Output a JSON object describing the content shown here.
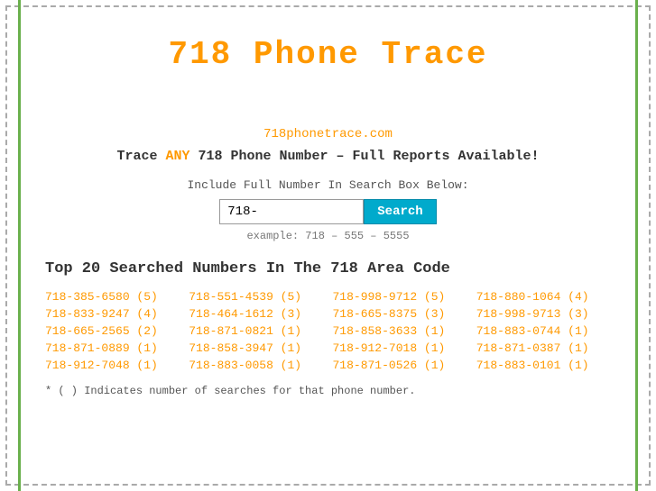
{
  "page": {
    "title": "718 Phone Trace",
    "site_url": "718phonetrace.com",
    "tagline_start": "Trace ",
    "tagline_highlight": "ANY",
    "tagline_end": " 718 Phone Number – Full Reports Available!",
    "search_label": "Include Full Number In Search Box Below:",
    "search_placeholder": "718-",
    "search_button_label": "Search",
    "search_example": "example: 718 – 555 – 5555",
    "section_title": "Top 20 Searched Numbers In The 718 Area Code",
    "footnote": "* ( ) Indicates number of searches for that phone number."
  },
  "numbers": [
    {
      "label": "718-385-6580 (5)",
      "col": 0
    },
    {
      "label": "718-551-4539 (5)",
      "col": 1
    },
    {
      "label": "718-998-9712 (5)",
      "col": 2
    },
    {
      "label": "718-880-1064 (4)",
      "col": 3
    },
    {
      "label": "718-833-9247 (4)",
      "col": 0
    },
    {
      "label": "718-464-1612 (3)",
      "col": 1
    },
    {
      "label": "718-665-8375 (3)",
      "col": 2
    },
    {
      "label": "718-998-9713 (3)",
      "col": 3
    },
    {
      "label": "718-665-2565 (2)",
      "col": 0
    },
    {
      "label": "718-871-0821 (1)",
      "col": 1
    },
    {
      "label": "718-858-3633 (1)",
      "col": 2
    },
    {
      "label": "718-883-0744 (1)",
      "col": 3
    },
    {
      "label": "718-871-0889 (1)",
      "col": 0
    },
    {
      "label": "718-858-3947 (1)",
      "col": 1
    },
    {
      "label": "718-912-7018 (1)",
      "col": 2
    },
    {
      "label": "718-871-0387 (1)",
      "col": 3
    },
    {
      "label": "718-912-7048 (1)",
      "col": 0
    },
    {
      "label": "718-883-0058 (1)",
      "col": 1
    },
    {
      "label": "718-871-0526 (1)",
      "col": 2
    },
    {
      "label": "718-883-0101 (1)",
      "col": 3
    }
  ]
}
